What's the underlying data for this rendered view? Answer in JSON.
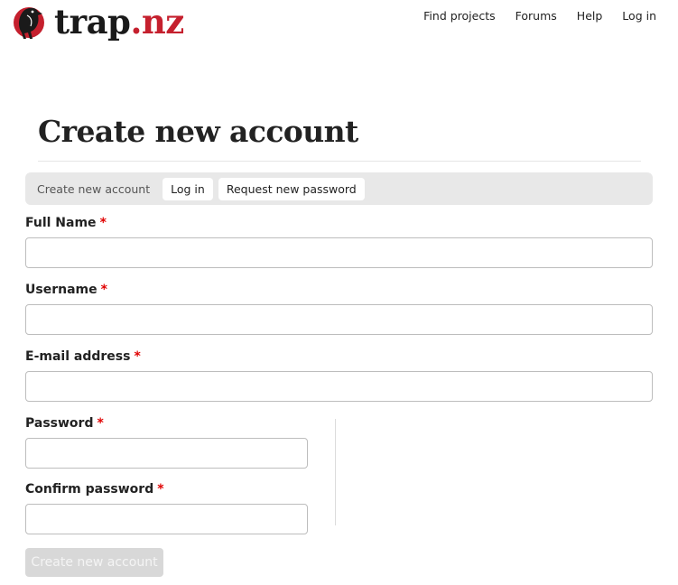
{
  "brand": {
    "name_main": "trap",
    "name_accent": ".nz",
    "accent_color": "#c5202e"
  },
  "topnav": {
    "items": [
      {
        "label": "Find projects"
      },
      {
        "label": "Forums"
      },
      {
        "label": "Help"
      },
      {
        "label": "Log in"
      }
    ]
  },
  "page": {
    "title": "Create new account"
  },
  "tabs": {
    "active": "Create new account",
    "items": [
      {
        "label": "Log in"
      },
      {
        "label": "Request new password"
      }
    ]
  },
  "form": {
    "required_marker": "*",
    "required_color": "#e00000",
    "fields": {
      "full_name": {
        "label": "Full Name",
        "value": ""
      },
      "username": {
        "label": "Username",
        "value": ""
      },
      "email": {
        "label": "E-mail address",
        "value": ""
      },
      "password": {
        "label": "Password",
        "value": ""
      },
      "confirm_password": {
        "label": "Confirm password",
        "value": ""
      }
    },
    "submit_label": "Create new account",
    "submit_disabled": true
  }
}
